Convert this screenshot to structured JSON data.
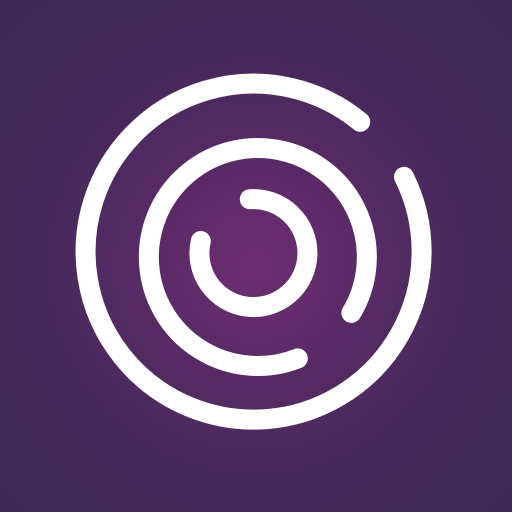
{
  "icon": {
    "name": "concentric-arcs-logo-icon",
    "colors": {
      "background_center": "#6e2e72",
      "background_edge": "#3c2853",
      "stroke": "#ffffff"
    }
  }
}
